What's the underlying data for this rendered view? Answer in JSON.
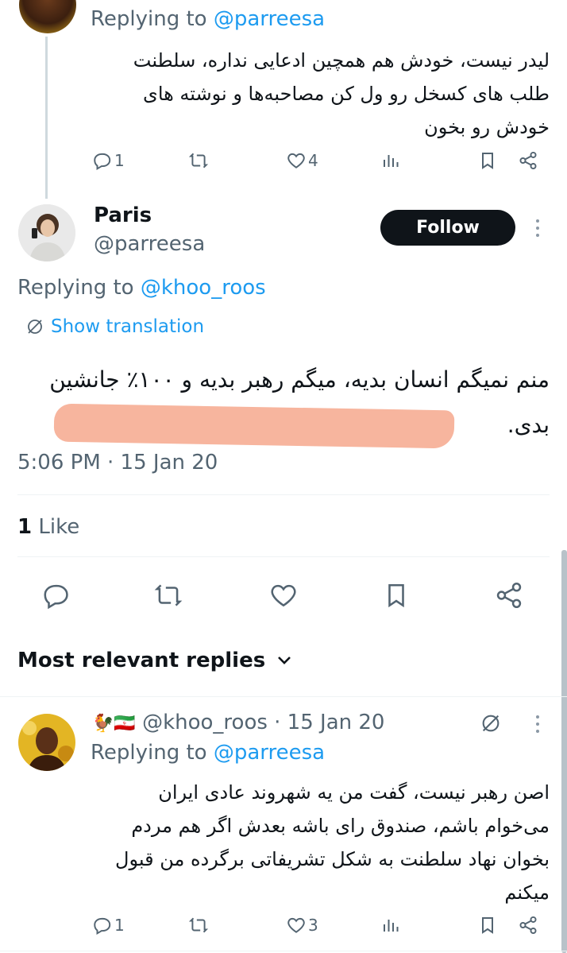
{
  "reply1": {
    "replying_prefix": "Replying to",
    "replying_handle": "@parreesa",
    "text": "لیدر نیست، خودش هم همچین ادعایی نداره، سلطنت طلب های کسخل رو ول کن مصاحبه‌ها و نوشته های خودش رو بخون",
    "stats": {
      "replies": "1",
      "reposts": "",
      "likes": "4"
    }
  },
  "main_tweet": {
    "name": "Paris",
    "handle": "@parreesa",
    "follow_label": "Follow",
    "replying_prefix": "Replying to",
    "replying_handle": "@khoo_roos",
    "show_translation": "Show translation",
    "text_line1": "منم نمیگم انسان بدیه، میگم رهبر بدیه و ۱۰۰٪ جانشین",
    "text_line2": "بدی.",
    "timestamp": "5:06 PM · 15 Jan 20",
    "likes_count": "1",
    "likes_label": "Like"
  },
  "replies_header": {
    "label": "Most relevant replies"
  },
  "reply2": {
    "flags": "🐓🇮🇷",
    "handle": "@khoo_roos",
    "time": "· 15 Jan 20",
    "replying_prefix": "Replying to",
    "replying_handle": "@parreesa",
    "text": "اصن رهبر نیست، گفت من یه شهروند عادی ایران می‌خوام باشم، صندوق رای باشه بعدش اگر هم مردم بخوان نهاد سلطنت به شکل تشریفاتی برگرده من قبول میکنم",
    "stats": {
      "replies": "1",
      "reposts": "",
      "likes": "3"
    }
  },
  "colors": {
    "accent": "#1d9bf0",
    "follow_bg": "#0f1419",
    "redaction": "#f7b59e"
  }
}
